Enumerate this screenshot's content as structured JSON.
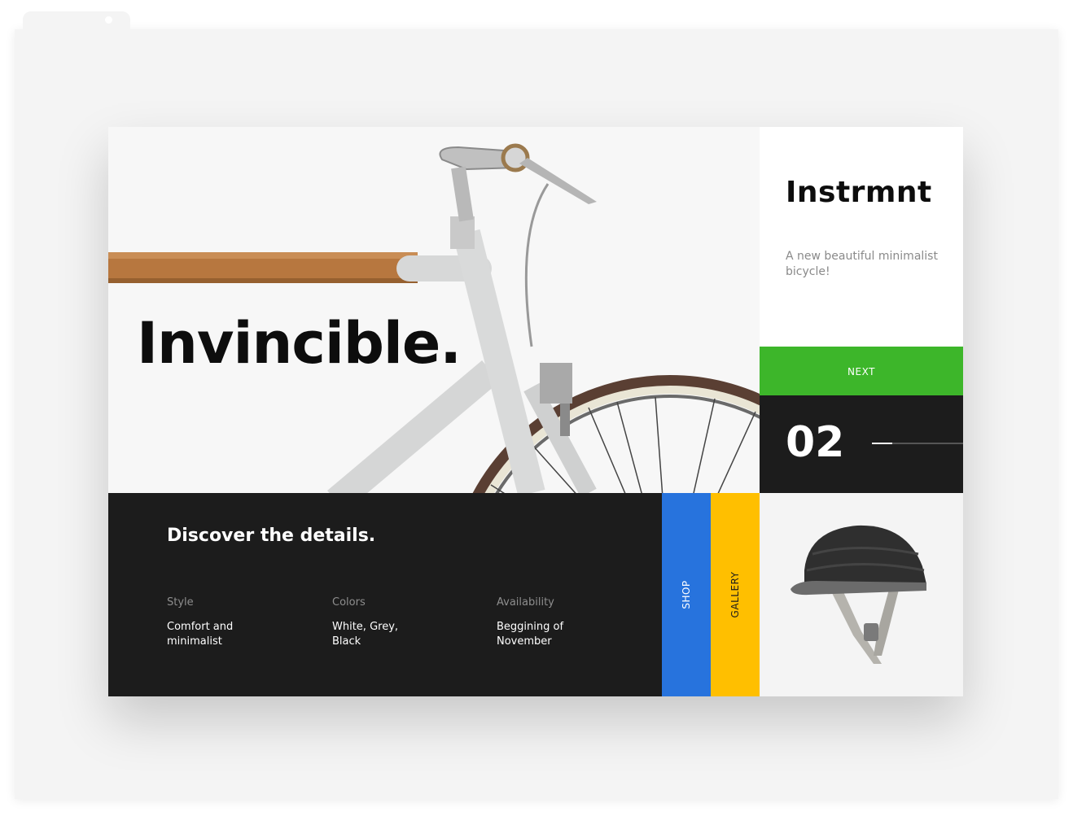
{
  "hero": {
    "title": "Invincible."
  },
  "brand": {
    "name": "Instrmnt",
    "description": "A new beautiful minimalist bicycle!"
  },
  "navigation": {
    "next_label": "NEXT"
  },
  "counter": {
    "current": "02",
    "progress_fraction": 0.22
  },
  "details": {
    "title": "Discover the details.",
    "specs": [
      {
        "label": "Style",
        "value": "Comfort and minimalist"
      },
      {
        "label": "Colors",
        "value": "White, Grey, Black"
      },
      {
        "label": "Availability",
        "value": "Beggining of November"
      }
    ]
  },
  "side_tabs": {
    "shop_label": "SHOP",
    "gallery_label": "GALLERY"
  },
  "colors": {
    "accent_green": "#3db62a",
    "shop_blue": "#2773dd",
    "gallery_yellow": "#ffbf00",
    "dark_panel": "#1c1c1c"
  }
}
